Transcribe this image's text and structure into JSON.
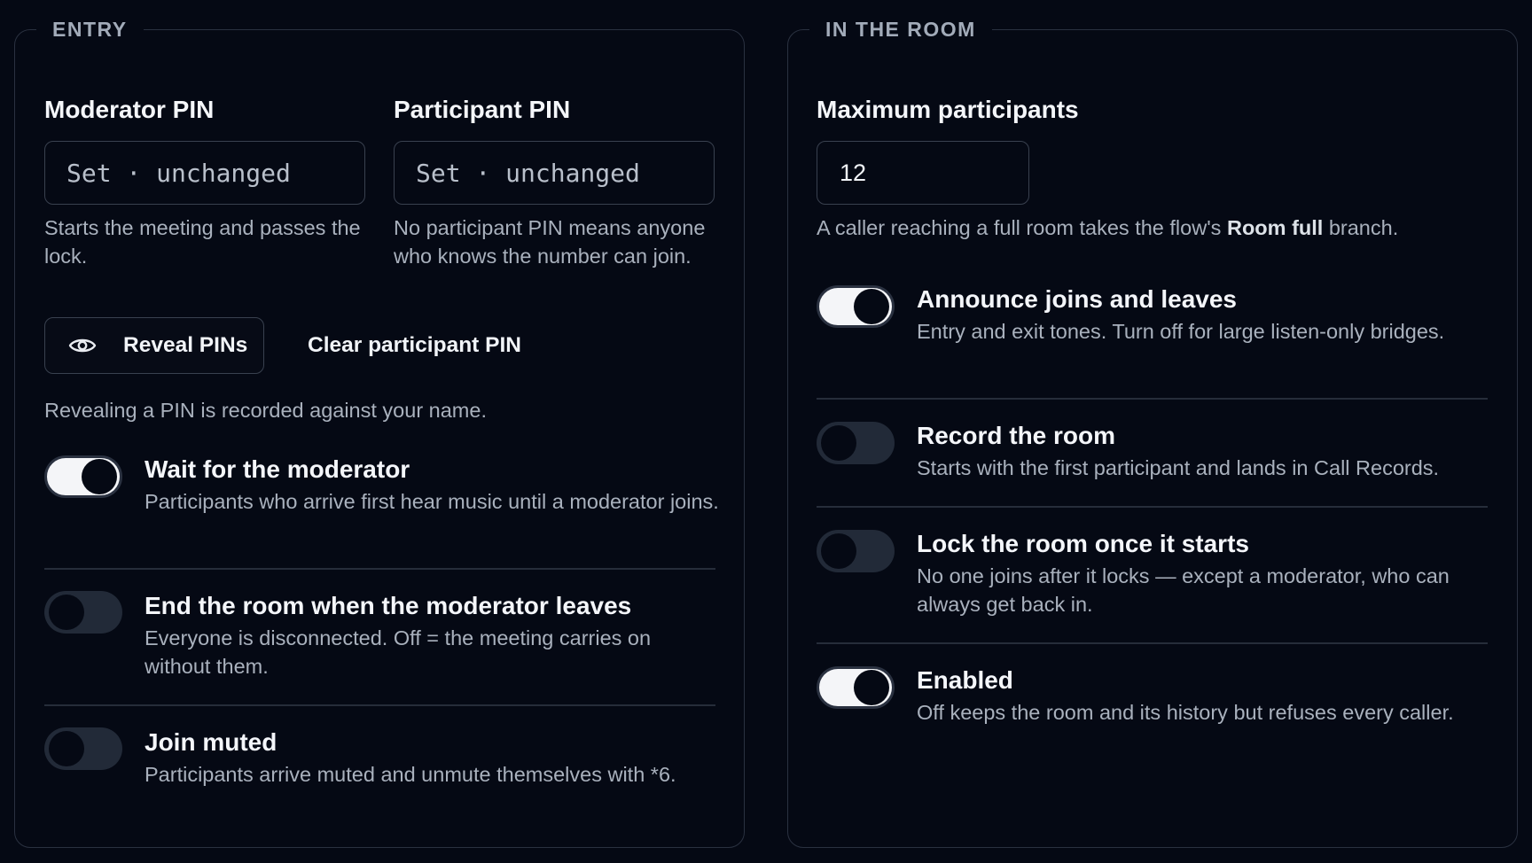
{
  "entry": {
    "legend": "ENTRY",
    "moderator_pin": {
      "label": "Moderator PIN",
      "placeholder": "Set · unchanged",
      "help": "Starts the meeting and passes the lock."
    },
    "participant_pin": {
      "label": "Participant PIN",
      "placeholder": "Set · unchanged",
      "help": "No participant PIN means anyone who knows the number can join."
    },
    "reveal_button": {
      "label": "Reveal PINs",
      "icon": "eye-icon"
    },
    "clear_button": {
      "label": "Clear participant PIN"
    },
    "reveal_note": "Revealing a PIN is recorded against your name.",
    "options": [
      {
        "title": "Wait for the moderator",
        "description": "Participants who arrive first hear music until a moderator joins.",
        "enabled": true
      },
      {
        "title": "End the room when the moderator leaves",
        "description": "Everyone is disconnected. Off = the meeting carries on without them.",
        "enabled": false
      },
      {
        "title": "Join muted",
        "description": "Participants arrive muted and unmute themselves with *6.",
        "enabled": false
      }
    ]
  },
  "room": {
    "legend": "IN THE ROOM",
    "max_participants": {
      "label": "Maximum participants",
      "value": "12",
      "help_before": "A caller reaching a full room takes the flow's ",
      "help_bold": "Room full",
      "help_after": " branch."
    },
    "options": [
      {
        "title": "Announce joins and leaves",
        "description": "Entry and exit tones. Turn off for large listen-only bridges.",
        "enabled": true
      },
      {
        "title": "Record the room",
        "description": "Starts with the first participant and lands in Call Records.",
        "enabled": false
      },
      {
        "title": "Lock the room once it starts",
        "description": "No one joins after it locks — except a moderator, who can always get back in.",
        "enabled": false
      },
      {
        "title": "Enabled",
        "description": "Off keeps the room and its history but refuses every caller.",
        "enabled": true
      }
    ]
  },
  "colors": {
    "background": "#050914",
    "panel_border": "#2a3140",
    "toggle_on": "#f4f5f8",
    "toggle_off": "#222a38",
    "muted_text": "#a9b1bd"
  }
}
